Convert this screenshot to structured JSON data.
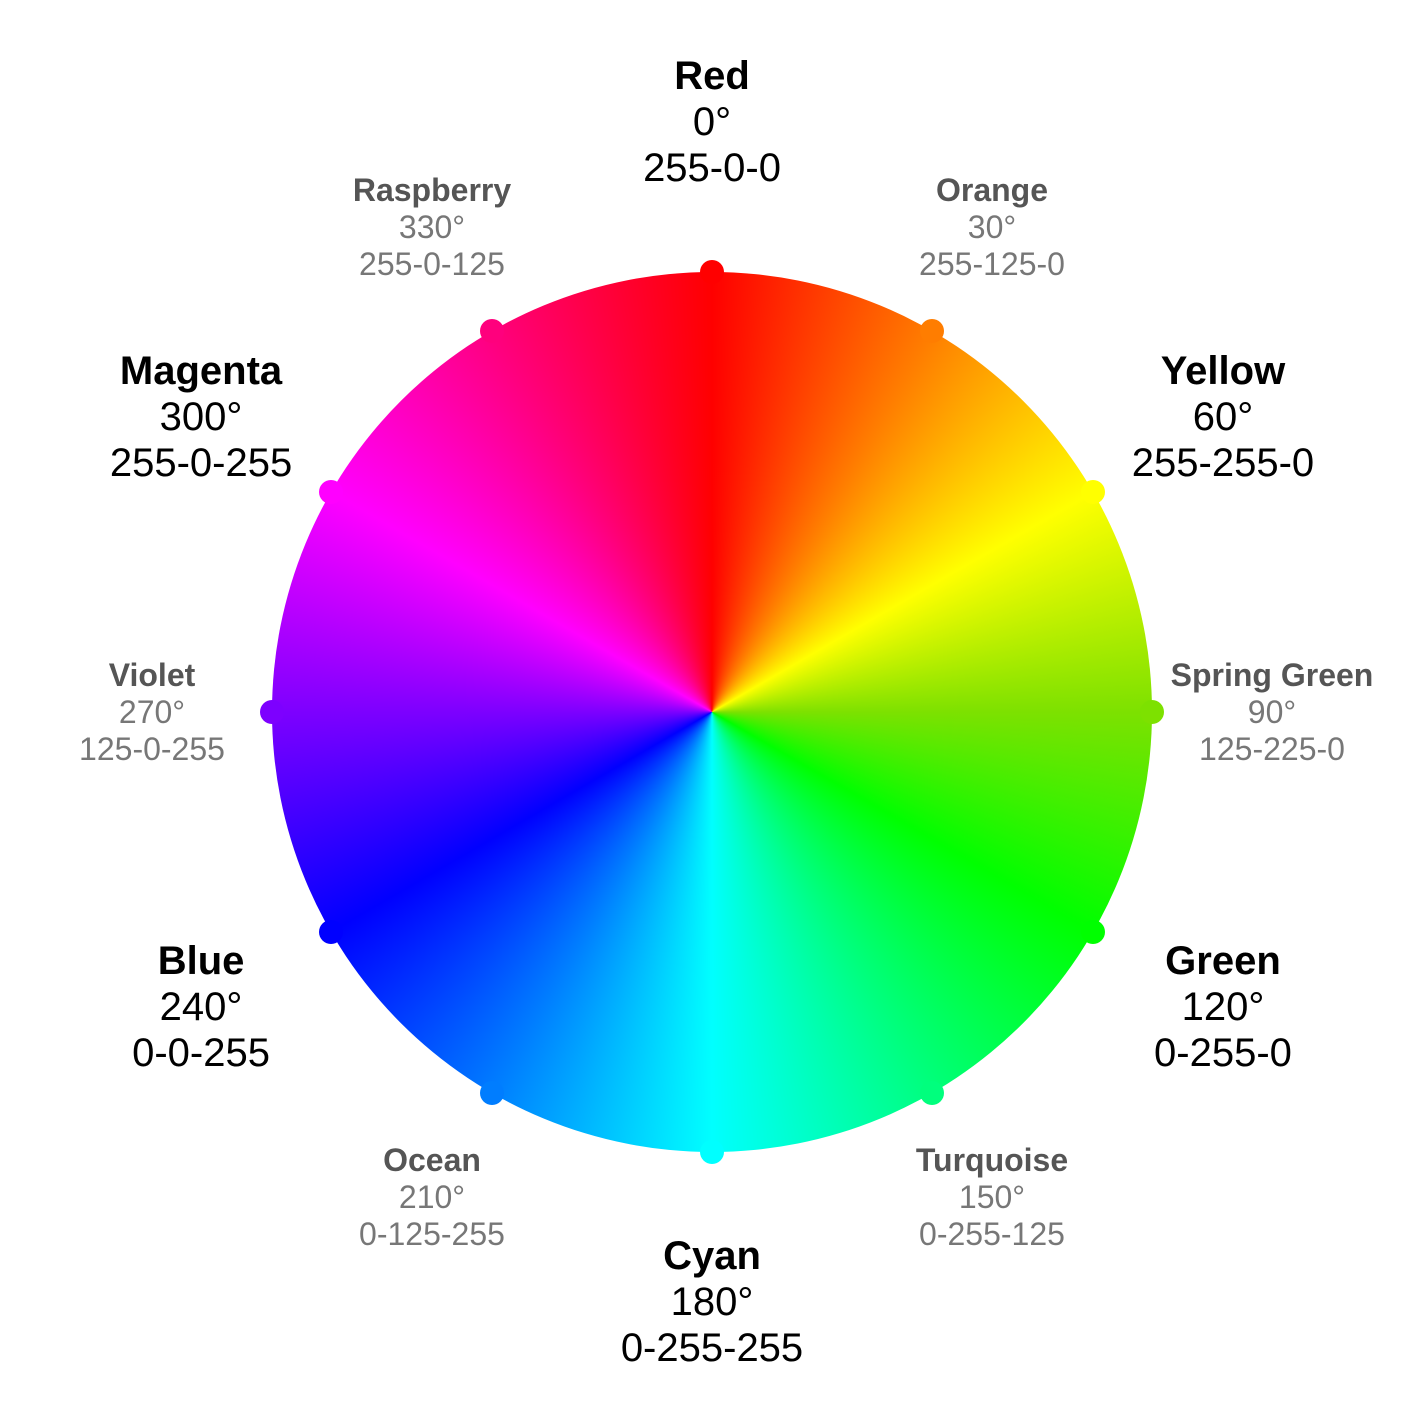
{
  "chart_data": {
    "type": "pie",
    "title": "",
    "center": [
      712,
      712
    ],
    "radius": 440,
    "series": [
      {
        "name": "Red",
        "angle": 0,
        "rgb": "255-0-0",
        "hex": "#ff0000",
        "primary": true
      },
      {
        "name": "Orange",
        "angle": 30,
        "rgb": "255-125-0",
        "hex": "#ff7d00",
        "primary": false
      },
      {
        "name": "Yellow",
        "angle": 60,
        "rgb": "255-255-0",
        "hex": "#ffff00",
        "primary": true
      },
      {
        "name": "Spring Green",
        "angle": 90,
        "rgb": "125-225-0",
        "hex": "#7de100",
        "primary": false
      },
      {
        "name": "Green",
        "angle": 120,
        "rgb": "0-255-0",
        "hex": "#00ff00",
        "primary": true
      },
      {
        "name": "Turquoise",
        "angle": 150,
        "rgb": "0-255-125",
        "hex": "#00ff7d",
        "primary": false
      },
      {
        "name": "Cyan",
        "angle": 180,
        "rgb": "0-255-255",
        "hex": "#00ffff",
        "primary": true
      },
      {
        "name": "Ocean",
        "angle": 210,
        "rgb": "0-125-255",
        "hex": "#007dff",
        "primary": false
      },
      {
        "name": "Blue",
        "angle": 240,
        "rgb": "0-0-255",
        "hex": "#0000ff",
        "primary": true
      },
      {
        "name": "Violet",
        "angle": 270,
        "rgb": "125-0-255",
        "hex": "#7d00ff",
        "primary": false
      },
      {
        "name": "Magenta",
        "angle": 300,
        "rgb": "255-0-255",
        "hex": "#ff00ff",
        "primary": true
      },
      {
        "name": "Raspberry",
        "angle": 330,
        "rgb": "255-0-125",
        "hex": "#ff007d",
        "primary": false
      }
    ]
  }
}
